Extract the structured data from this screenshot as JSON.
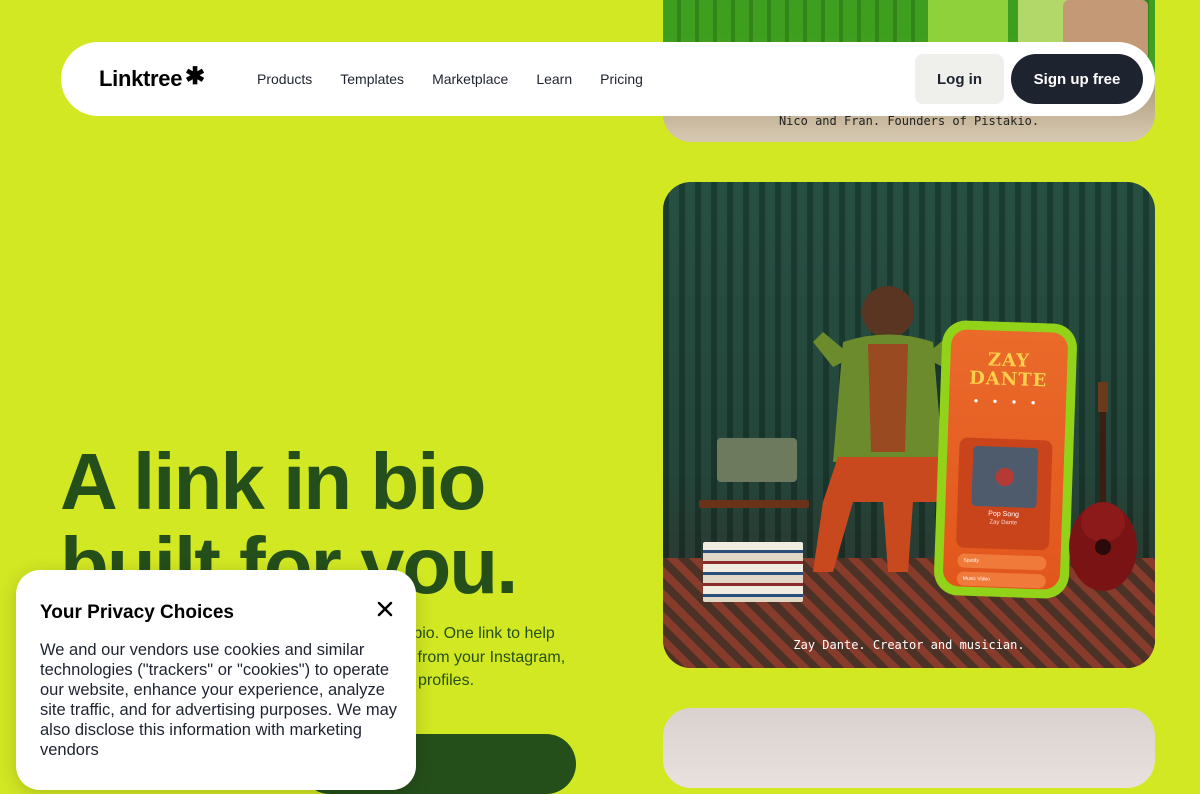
{
  "nav": {
    "logo_text": "Linktree",
    "logo_icon": "asterisk-icon",
    "links": [
      "Products",
      "Templates",
      "Marketplace",
      "Learn",
      "Pricing"
    ],
    "login_label": "Log in",
    "signup_label": "Sign up free"
  },
  "hero": {
    "title_line1": "A link in bio",
    "title_line2": "built for you.",
    "subtitle_visible_parts": [
      "n bio. One link to help",
      "ll from your Instagram,",
      "profiles."
    ]
  },
  "cards": {
    "top_caption": "Nico and Fran. Founders of Pistakio.",
    "mid_caption": "Zay Dante. Creator and musician.",
    "phone_title_line1": "ZAY",
    "phone_title_line2": "DANTE",
    "phone_song": "Pop Song",
    "phone_artist": "Zay Dante",
    "phone_button1": "Spotify",
    "phone_button2": "Music Video"
  },
  "privacy": {
    "title": "Your Privacy Choices",
    "close_icon": "close-icon",
    "body": "We and our vendors use cookies and similar technologies (\"trackers\" or \"cookies\") to operate our website, enhance your experience, analyze site traffic, and for advertising purposes. We may also disclose this information with marketing vendors"
  },
  "colors": {
    "background": "#d2e823",
    "hero_text": "#254f1a",
    "signup_bg": "#1e2330",
    "login_bg": "#eff0ec"
  }
}
